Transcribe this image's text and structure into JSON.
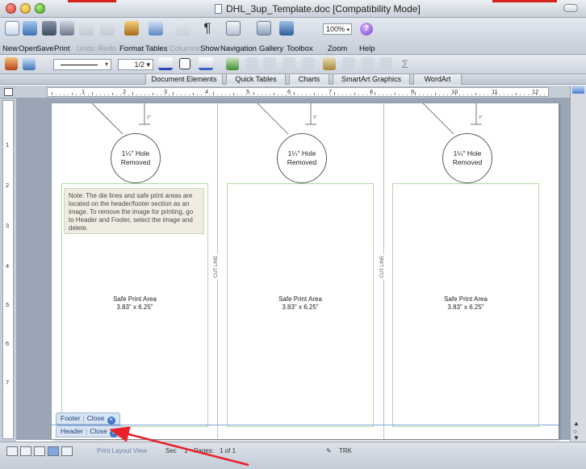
{
  "window": {
    "title": "DHL_3up_Template.doc [Compatibility Mode]"
  },
  "standard_toolbar": {
    "items": [
      {
        "label": "New",
        "dim": false
      },
      {
        "label": "Open",
        "dim": false
      },
      {
        "label": "Save",
        "dim": false
      },
      {
        "label": "Print",
        "dim": false
      },
      {
        "label": "Undo",
        "dim": true
      },
      {
        "label": "Redo",
        "dim": true
      },
      {
        "label": "Format",
        "dim": false
      },
      {
        "label": "Tables",
        "dim": false
      },
      {
        "label": "Columns",
        "dim": true
      },
      {
        "label": "Show",
        "dim": false
      },
      {
        "label": "Navigation",
        "dim": false
      },
      {
        "label": "Gallery",
        "dim": false
      },
      {
        "label": "Toolbox",
        "dim": false
      },
      {
        "label": "Zoom",
        "dim": false
      },
      {
        "label": "Help",
        "dim": false
      }
    ],
    "zoom_value": "100%",
    "help_glyph": "?"
  },
  "formatting_toolbar": {
    "line_weight": "1/2"
  },
  "elements_gallery": {
    "tabs": [
      "Document Elements",
      "Quick Tables",
      "Charts",
      "SmartArt Graphics",
      "WordArt"
    ]
  },
  "ruler": {
    "numbers": [
      "1",
      "2",
      "3",
      "4",
      "5",
      "6",
      "7",
      "8",
      "9",
      "10",
      "11",
      "12"
    ],
    "vertical_numbers": [
      "1",
      "2",
      "3",
      "4",
      "5",
      "6",
      "7"
    ]
  },
  "document": {
    "panels": [
      {
        "hole_line1": "1¼\" Hole",
        "hole_line2": "Removed",
        "safe_line1": "Safe Print Area",
        "safe_line2": "3.83\" x 6.25\"",
        "dim_label": "3\""
      },
      {
        "hole_line1": "1¼\" Hole",
        "hole_line2": "Removed",
        "safe_line1": "Safe Print Area",
        "safe_line2": "3.83\" x 6.25\"",
        "dim_label": "3\""
      },
      {
        "hole_line1": "1¼\" Hole",
        "hole_line2": "Removed",
        "safe_line1": "Safe Print Area",
        "safe_line2": "3.83\" x 6.25\"",
        "dim_label": "3\""
      }
    ],
    "cut_line_label": "CUT LINE",
    "note": "Note:  The die lines and safe print areas are located on the header/footer section as an image.  To remove the image for printing, go to Header and Footer, select the image and delete."
  },
  "header_footer": {
    "footer_label": "Footer",
    "header_label": "Header",
    "close_label": "Close"
  },
  "statusbar": {
    "view_label": "Print Layout View",
    "sec_label": "Sec",
    "sec_value": "1",
    "pages_label": "Pages:",
    "pages_value": "1 of 1",
    "trk_label": "TRK"
  },
  "colors": {
    "annotation_arrow": "#e8212b",
    "safe_area_border": "#b3d9a6",
    "note_background": "#efece1"
  }
}
